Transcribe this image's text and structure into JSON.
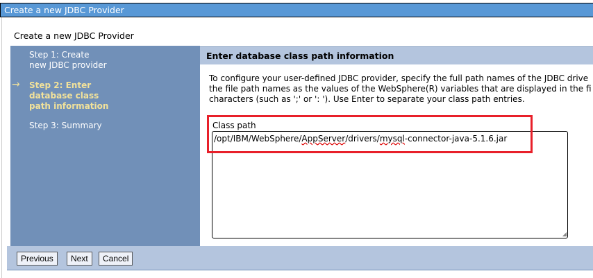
{
  "window": {
    "title": "Create a new JDBC Provider"
  },
  "page": {
    "subtitle": "Create a new JDBC Provider"
  },
  "steps": [
    {
      "l1": "Step 1: Create",
      "l2": "new JDBC provider"
    },
    {
      "l1": "Step 2: Enter",
      "l2": "database class",
      "l3": "path information",
      "current": true
    },
    {
      "l1": "Step 3: Summary"
    }
  ],
  "content": {
    "header": "Enter database class path information",
    "desc": [
      "To configure your user-defined JDBC provider, specify the full path names of the JDBC drive",
      "the file path names as the values of the WebSphere(R) variables that are displayed in the fi",
      "characters (such as ';' or ': '). Use Enter to separate your class path entries."
    ],
    "classpath_label": "Class path",
    "classpath_parts": [
      "/opt/IBM/WebSphere/",
      "AppServer",
      "/drivers/",
      "mysql",
      "-connector-java-5.1.6.jar"
    ]
  },
  "buttons": {
    "previous": "Previous",
    "next": "Next",
    "cancel": "Cancel"
  },
  "colors": {
    "title": "#5898d6",
    "sidebar": "#7190b8",
    "panel": "#b4c5de",
    "highlight": "#e8202a"
  }
}
